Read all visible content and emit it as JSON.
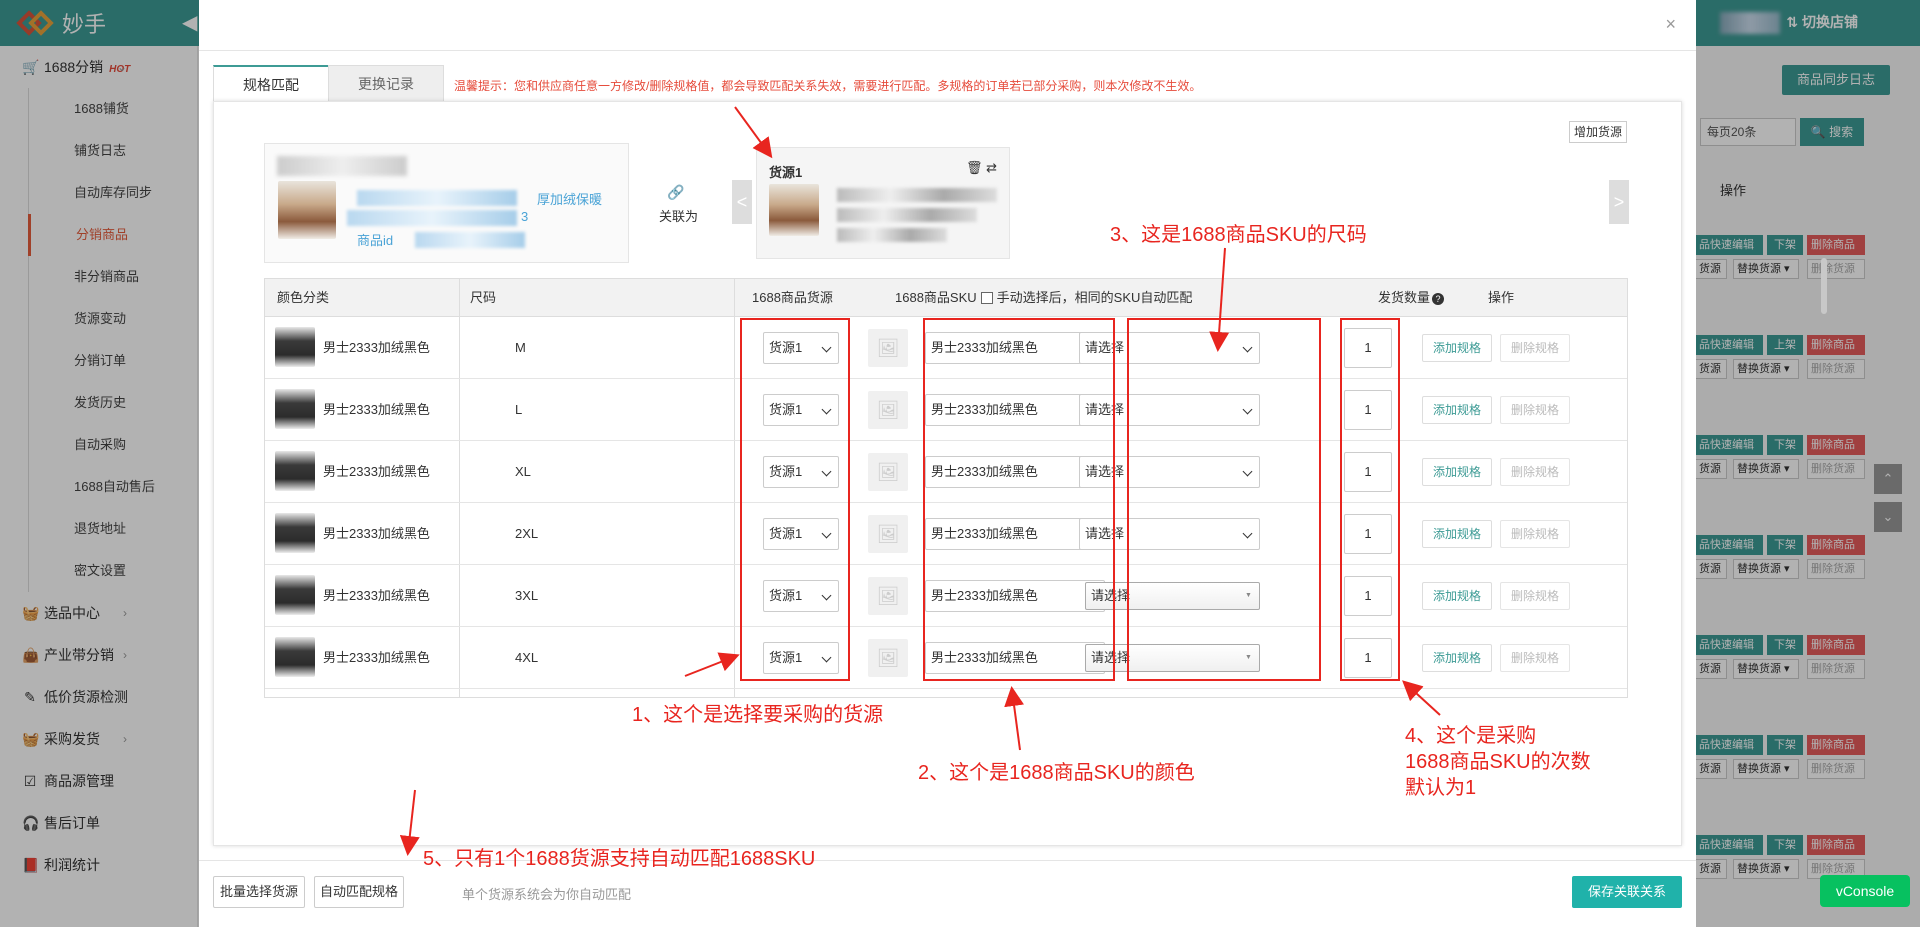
{
  "app": {
    "logo_text": "妙手",
    "switch_store": "⇅ 切换店铺"
  },
  "sidebar": {
    "group1": {
      "label": "1688分销",
      "badge": "HOT"
    },
    "subitems": [
      "1688铺货",
      "铺货日志",
      "自动库存同步",
      "分销商品",
      "非分销商品",
      "货源变动",
      "分销订单",
      "发货历史",
      "自动采购",
      "1688自动售后",
      "退货地址",
      "密文设置"
    ],
    "active_sub": "分销商品",
    "groups": [
      {
        "label": "选品中心",
        "icon": "basket-icon"
      },
      {
        "label": "产业带分销",
        "icon": "bag-icon"
      },
      {
        "label": "低价货源检测",
        "icon": "edit-icon"
      },
      {
        "label": "采购发货",
        "icon": "basket-icon"
      },
      {
        "label": "商品源管理",
        "icon": "checkbox-icon"
      },
      {
        "label": "售后订单",
        "icon": "headset-icon"
      },
      {
        "label": "利润统计",
        "icon": "book-icon"
      }
    ]
  },
  "background": {
    "sync_log": "商品同步日志",
    "page_size": "每页20条",
    "search": "搜索",
    "op_header": "操作",
    "row_buttons": {
      "quick_edit": "品快速编辑",
      "shelf_down": "下架",
      "shelf_up": "上架",
      "delete": "删除商品",
      "src": "货源",
      "replace": "替换货源 ▾",
      "del_src": "删除货源"
    },
    "row_states": [
      "下架",
      "上架",
      "下架",
      "下架",
      "下架",
      "下架",
      "下架"
    ]
  },
  "vconsole": "vConsole",
  "modal": {
    "tabs": [
      "规格匹配",
      "更换记录"
    ],
    "tip": "温馨提示：您和供应商任意一方修改/删除规格值，都会导致匹配关系失效，需要进行匹配。多规格的订单若已部分采购，则本次修改不生效。",
    "add_source": "增加货源",
    "product": {
      "link_text_end": "厚加绒保暖",
      "link_line2_end": "3",
      "id_label": "商品id"
    },
    "link_label": "关联为",
    "source_card": {
      "title": "货源1"
    },
    "table": {
      "headers": {
        "color": "颜色分类",
        "size": "尺码",
        "src": "1688商品货源",
        "sku": "1688商品SKU",
        "manual": "手动选择后，相同的SKU自动匹配",
        "qty": "发货数量",
        "op": "操作"
      },
      "rows": [
        {
          "color": "男士2333加绒黑色",
          "size": "M",
          "source": "货源1",
          "sku_color": "男士2333加绒黑色",
          "sku_size": "请选择",
          "qty": "1",
          "add": "添加规格",
          "del": "删除规格"
        },
        {
          "color": "男士2333加绒黑色",
          "size": "L",
          "source": "货源1",
          "sku_color": "男士2333加绒黑色",
          "sku_size": "请选择",
          "qty": "1",
          "add": "添加规格",
          "del": "删除规格"
        },
        {
          "color": "男士2333加绒黑色",
          "size": "XL",
          "source": "货源1",
          "sku_color": "男士2333加绒黑色",
          "sku_size": "请选择",
          "qty": "1",
          "add": "添加规格",
          "del": "删除规格"
        },
        {
          "color": "男士2333加绒黑色",
          "size": "2XL",
          "source": "货源1",
          "sku_color": "男士2333加绒黑色",
          "sku_size": "请选择",
          "qty": "1",
          "add": "添加规格",
          "del": "删除规格"
        },
        {
          "color": "男士2333加绒黑色",
          "size": "3XL",
          "source": "货源1",
          "sku_color": "男士2333加绒黑色",
          "sku_size": "请选择",
          "qty": "1",
          "add": "添加规格",
          "del": "删除规格"
        },
        {
          "color": "男士2333加绒黑色",
          "size": "4XL",
          "source": "货源1",
          "sku_color": "男士2333加绒黑色",
          "sku_size": "请选择",
          "qty": "1",
          "add": "添加规格",
          "del": "删除规格"
        }
      ]
    },
    "footer": {
      "batch": "批量选择货源",
      "auto": "自动匹配规格",
      "tip": "单个货源系统会为你自动匹配",
      "save": "保存关联关系"
    }
  },
  "annotations": {
    "a1": "1、这个是选择要采购的货源",
    "a2": "2、这个是1688商品SKU的颜色",
    "a3": "3、这是1688商品SKU的尺码",
    "a4_l1": "4、这个是采购",
    "a4_l2": "1688商品SKU的次数",
    "a4_l3": "默认为1",
    "a5": "5、只有1个1688货源支持自动匹配1688SKU",
    "color": "#e8251f"
  }
}
